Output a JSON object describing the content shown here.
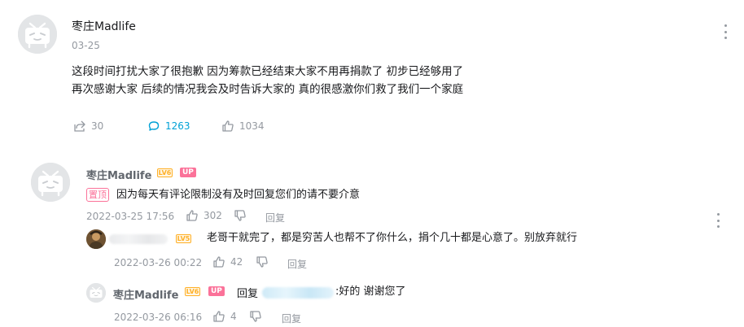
{
  "main_comment": {
    "username": "枣庄Madlife",
    "date": "03-25",
    "lines": [
      "这段时间打扰大家了很抱歉 因为筹款已经结束大家不用再捐款了 初步已经够用了",
      "再次感谢大家 后续的情况我会及时告诉大家的 真的很感激你们救了我们一个家庭"
    ],
    "share_count": "30",
    "comment_count": "1263",
    "like_count": "1034"
  },
  "pinned_comment": {
    "username": "枣庄Madlife",
    "level_badge": "LV6",
    "up_badge": "UP",
    "pin_badge": "置顶",
    "text": "因为每天有评论限制没有及时回复您们的请不要介意",
    "datetime": "2022-03-25 17:56",
    "like_count": "302",
    "reply_label": "回复"
  },
  "replies": [
    {
      "level_badge": "LV5",
      "text": "老哥干就完了，都是穷苦人也帮不了你什么，捐个几十都是心意了。别放弃就行",
      "datetime": "2022-03-26 00:22",
      "like_count": "42",
      "reply_label": "回复"
    },
    {
      "username": "枣庄Madlife",
      "level_badge": "LV6",
      "up_badge": "UP",
      "reply_prefix": "回复",
      "text": ":好的 谢谢您了",
      "datetime": "2022-03-26 06:16",
      "like_count": "4",
      "reply_label": "回复"
    }
  ],
  "colors": {
    "accent": "#00a1d6",
    "pink": "#fb7299",
    "level": "#ffb027",
    "muted": "#9499a0"
  },
  "icons": [
    "tv-avatar-icon",
    "share-icon",
    "comment-icon",
    "thumb-up-icon",
    "thumb-down-icon",
    "more-icon"
  ]
}
